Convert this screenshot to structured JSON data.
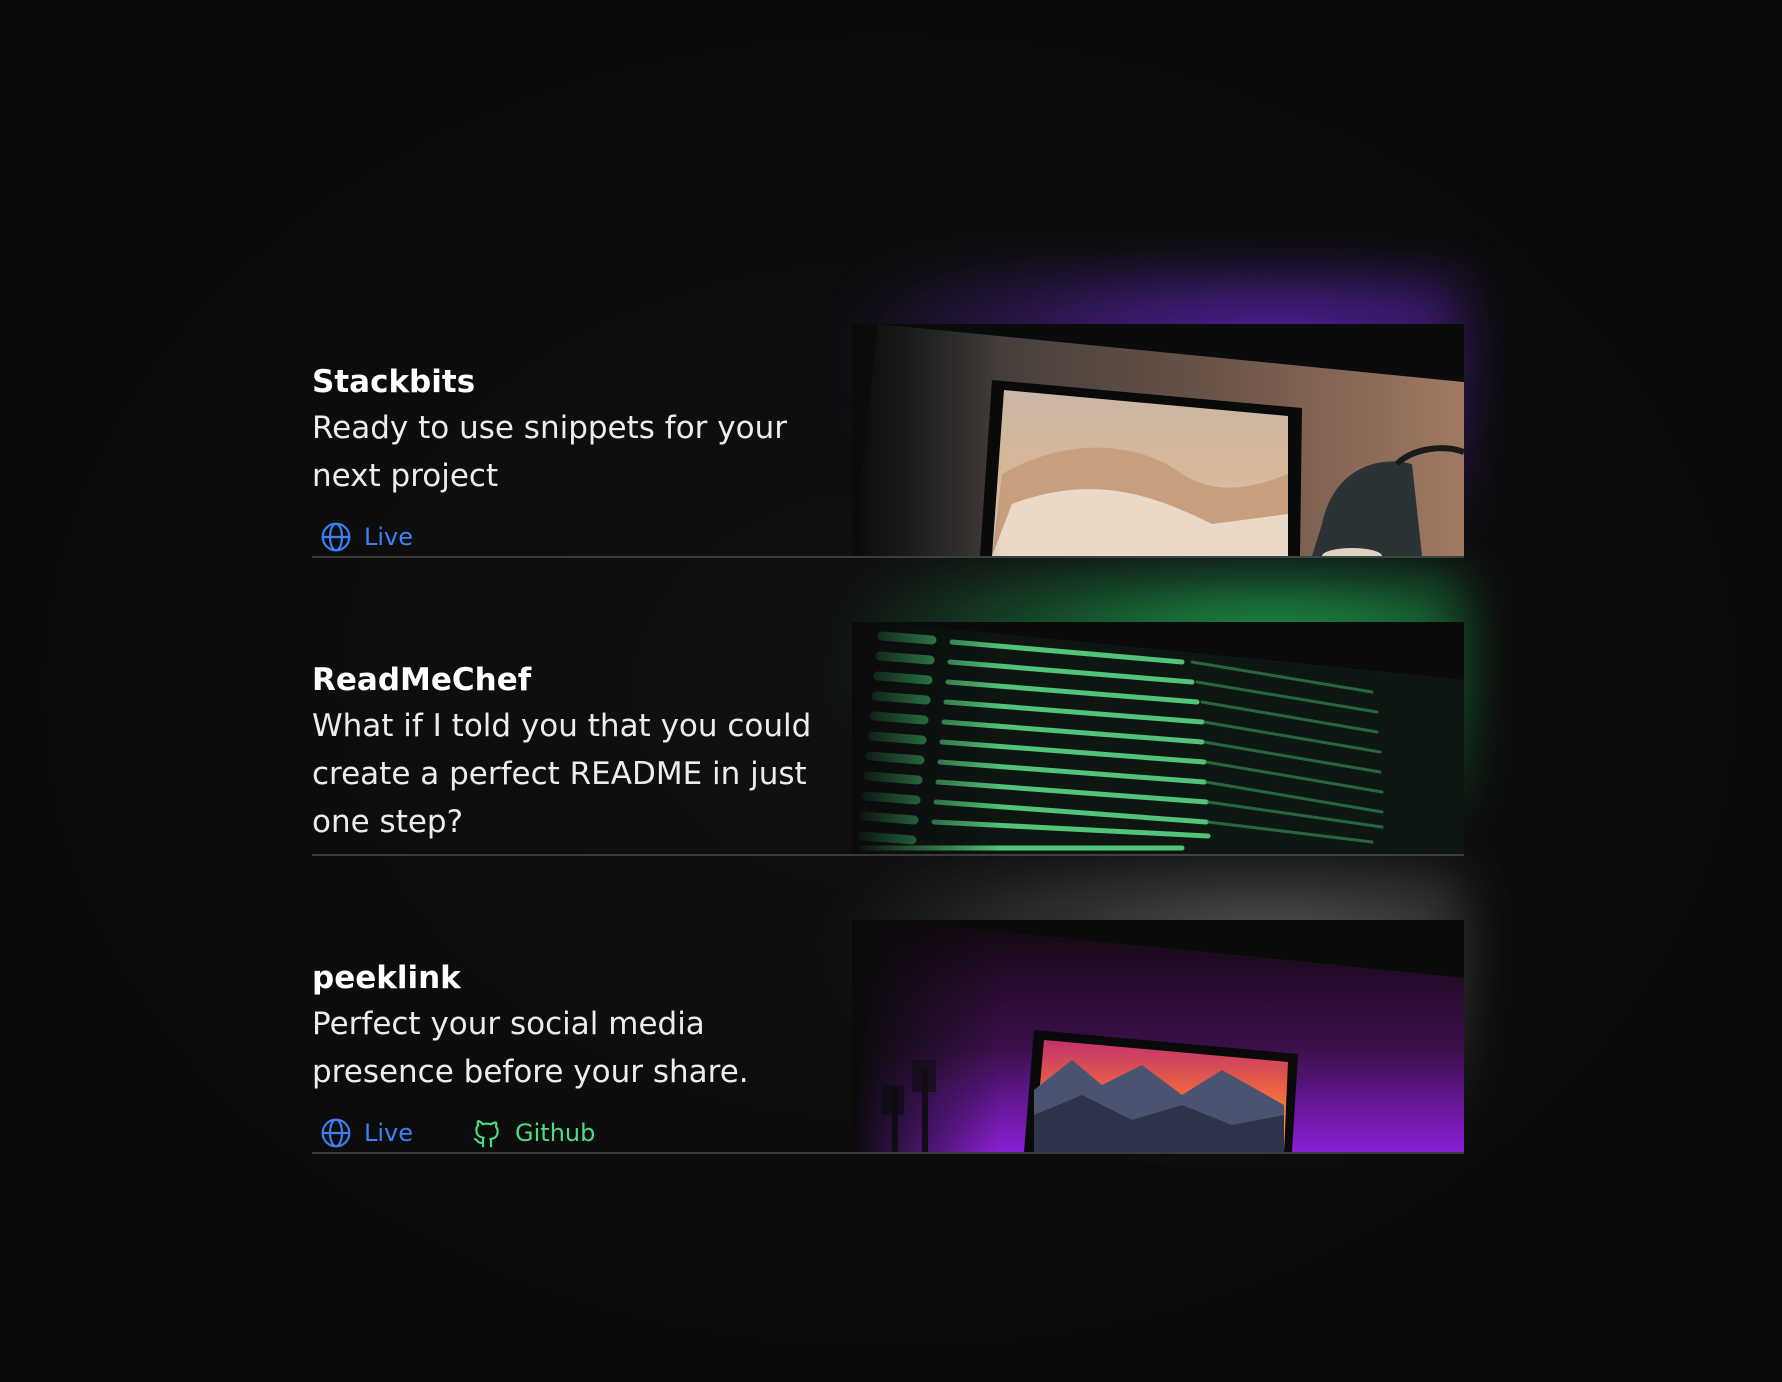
{
  "projects": [
    {
      "title": "Stackbits",
      "description": "Ready to use snippets for your next project",
      "links": [
        {
          "label": "Live",
          "icon": "globe-icon"
        }
      ],
      "image": "laptop-desert-wallpaper-lamp",
      "glow_color": "#6d28d9"
    },
    {
      "title": "ReadMeChef",
      "description": "What if I told you that you could create a perfect README in just one step?",
      "links": [],
      "image": "terminal-green-output",
      "glow_color": "#22c55e"
    },
    {
      "title": "peeklink",
      "description": "Perfect your social media presence before your share.",
      "links": [
        {
          "label": "Live",
          "icon": "globe-icon"
        },
        {
          "label": "Github",
          "icon": "github-icon"
        }
      ],
      "image": "laptop-purple-mountain-sunset",
      "glow_color": "#9333ea"
    }
  ],
  "colors": {
    "background": "#0b0b0b",
    "live_link": "#3b82f6",
    "github_link": "#4ade80",
    "divider": "#3a3a3a"
  }
}
